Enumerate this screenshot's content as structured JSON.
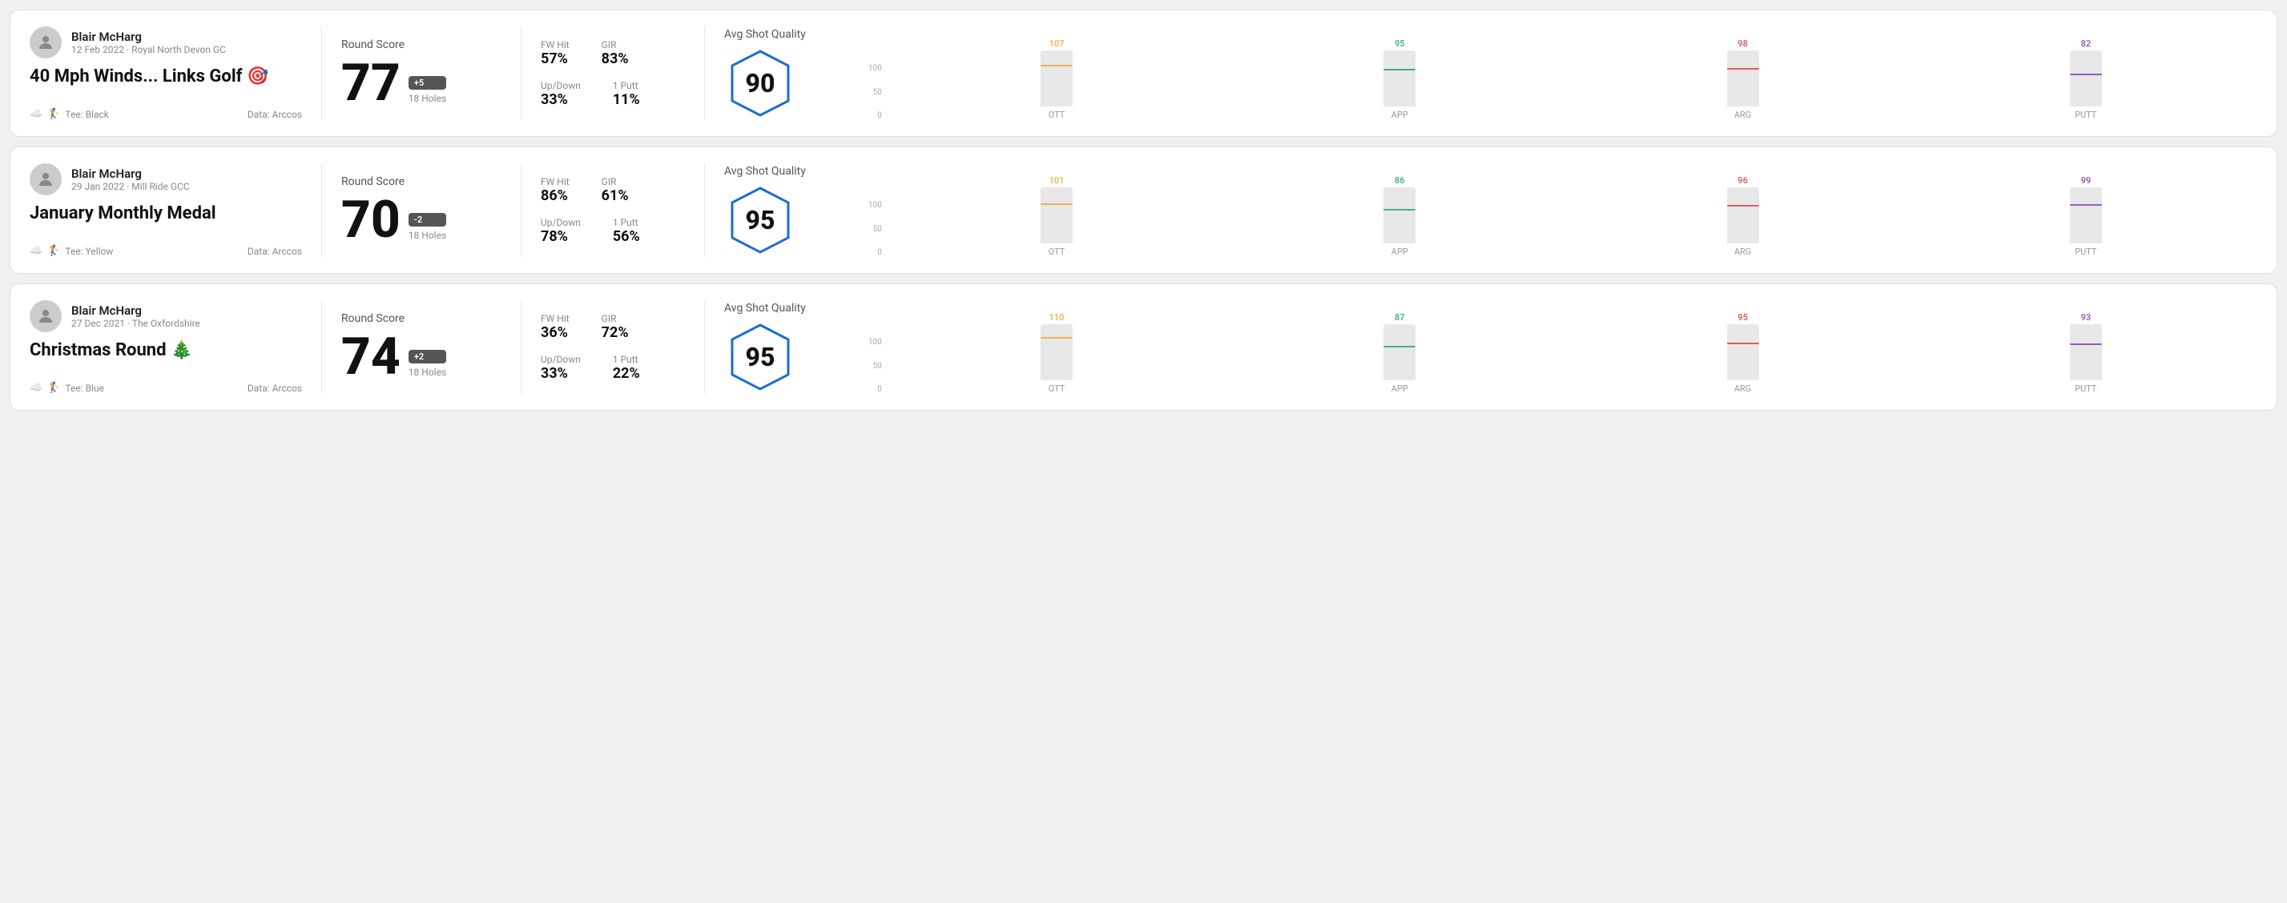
{
  "rounds": [
    {
      "userName": "Blair McHarg",
      "userMeta": "12 Feb 2022 · Royal North Devon GC",
      "title": "40 Mph Winds... Links Golf 🎯",
      "tee": "Tee: Black",
      "dataSource": "Data: Arccos",
      "roundScore": "77",
      "scoreDiff": "+5",
      "holes": "18 Holes",
      "fwHit": "57%",
      "gir": "83%",
      "upDown": "33%",
      "onePutt": "11%",
      "avgShotQuality": "Avg Shot Quality",
      "quality": "90",
      "chart": {
        "ott": {
          "label": "OTT",
          "value": "107",
          "fillPct": 72
        },
        "app": {
          "label": "APP",
          "value": "95",
          "fillPct": 64
        },
        "arg": {
          "label": "ARG",
          "value": "98",
          "fillPct": 66
        },
        "putt": {
          "label": "PUTT",
          "value": "82",
          "fillPct": 55
        }
      }
    },
    {
      "userName": "Blair McHarg",
      "userMeta": "29 Jan 2022 · Mill Ride GCC",
      "title": "January Monthly Medal",
      "tee": "Tee: Yellow",
      "dataSource": "Data: Arccos",
      "roundScore": "70",
      "scoreDiff": "-2",
      "holes": "18 Holes",
      "fwHit": "86%",
      "gir": "61%",
      "upDown": "78%",
      "onePutt": "56%",
      "avgShotQuality": "Avg Shot Quality",
      "quality": "95",
      "chart": {
        "ott": {
          "label": "OTT",
          "value": "101",
          "fillPct": 68
        },
        "app": {
          "label": "APP",
          "value": "86",
          "fillPct": 58
        },
        "arg": {
          "label": "ARG",
          "value": "96",
          "fillPct": 65
        },
        "putt": {
          "label": "PUTT",
          "value": "99",
          "fillPct": 67
        }
      }
    },
    {
      "userName": "Blair McHarg",
      "userMeta": "27 Dec 2021 · The Oxfordshire",
      "title": "Christmas Round 🎄",
      "tee": "Tee: Blue",
      "dataSource": "Data: Arccos",
      "roundScore": "74",
      "scoreDiff": "+2",
      "holes": "18 Holes",
      "fwHit": "36%",
      "gir": "72%",
      "upDown": "33%",
      "onePutt": "22%",
      "avgShotQuality": "Avg Shot Quality",
      "quality": "95",
      "chart": {
        "ott": {
          "label": "OTT",
          "value": "110",
          "fillPct": 74
        },
        "app": {
          "label": "APP",
          "value": "87",
          "fillPct": 59
        },
        "arg": {
          "label": "ARG",
          "value": "95",
          "fillPct": 64
        },
        "putt": {
          "label": "PUTT",
          "value": "93",
          "fillPct": 63
        }
      }
    }
  ],
  "axisLabels": [
    "100",
    "50",
    "0"
  ],
  "statLabels": {
    "fwHit": "FW Hit",
    "gir": "GIR",
    "upDown": "Up/Down",
    "onePutt": "1 Putt"
  }
}
